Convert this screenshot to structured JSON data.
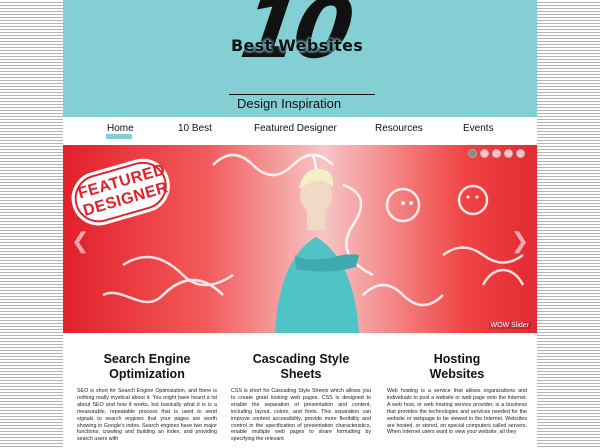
{
  "logo": {
    "number": "10",
    "title": "Best Websites",
    "subtitle": "Design Inspiration"
  },
  "nav": {
    "items": [
      "Home",
      "10 Best",
      "Featured Designer",
      "Resources",
      "Events"
    ],
    "active": "Home"
  },
  "banner": {
    "badge_line1": "FEATURED",
    "badge_line2": "DESIGNER",
    "slider_credit": "WOW Slider",
    "prev_arrow": "chevron-left-icon",
    "next_arrow": "chevron-right-icon",
    "slide_count": 5,
    "active_slide": 1
  },
  "columns": [
    {
      "title_line1": "Search Engine",
      "title_line2": "Optimization",
      "body": "SEO is short for Search Engine Optimization, and there is nothing really mystical about it. You might have heard a lot about SEO and how it works, but basically what it is is a measurable, repeatable process that is used to send signals to search engines that your pages are worth showing in Google's index. Search engines have two major functions: crawling and building an index, and providing search users with"
    },
    {
      "title_line1": "Cascading Style",
      "title_line2": "Sheets",
      "body": "CSS is short for Cascading Style Sheets which allows you to create great looking web pages. CSS is designed to enable the separation of presentation and content, including layout, colors, and fonts. This separation can improve content accessibility, provide more flexibility and control in the specification of presentation characteristics, enable multiple web pages to share formatting by specifying the relevant"
    },
    {
      "title_line1": "Hosting",
      "title_line2": "Websites",
      "body": "Web hosting is a service that allows organizations and individuals to post a website or web page onto the Internet. A web host, or web hosting service provider, is a business that provides the technologies and services needed for the website or webpage to be viewed in the Internet. Websites are hosted, or stored, on special computers called servers. When Internet users want to view your website, all they"
    }
  ],
  "colors": {
    "header_bg": "#84cfd4",
    "accent": "#84cfd4",
    "banner_red": "#e21f2a"
  }
}
